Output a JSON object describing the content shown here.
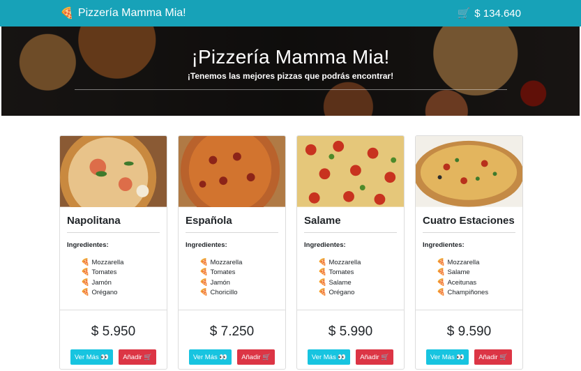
{
  "nav": {
    "brand": "Pizzería Mamma Mia!",
    "cart_total": "$ 134.640",
    "brand_icon": "pizza-slice-icon",
    "cart_icon": "cart-icon"
  },
  "hero": {
    "title": "¡Pizzería Mamma Mia!",
    "subtitle": "¡Tenemos las mejores pizzas que podrás encontrar!"
  },
  "labels": {
    "ingredients": "Ingredientes:",
    "more": "Ver Más 👀",
    "add": "Añadir 🛒"
  },
  "colors": {
    "primary": "#17a2b8",
    "info_button": "#17c4e0",
    "danger_button": "#dc3545"
  },
  "pizzas": [
    {
      "name": "Napolitana",
      "price": "$ 5.950",
      "ingredients": [
        "Mozzarella",
        "Tomates",
        "Jamón",
        "Orégano"
      ]
    },
    {
      "name": "Española",
      "price": "$ 7.250",
      "ingredients": [
        "Mozzarella",
        "Tomates",
        "Jamón",
        "Choricillo"
      ]
    },
    {
      "name": "Salame",
      "price": "$ 5.990",
      "ingredients": [
        "Mozzarella",
        "Tomates",
        "Salame",
        "Orégano"
      ]
    },
    {
      "name": "Cuatro Estaciones",
      "price": "$ 9.590",
      "ingredients": [
        "Mozzarella",
        "Salame",
        "Aceitunas",
        "Champiñones"
      ]
    }
  ]
}
